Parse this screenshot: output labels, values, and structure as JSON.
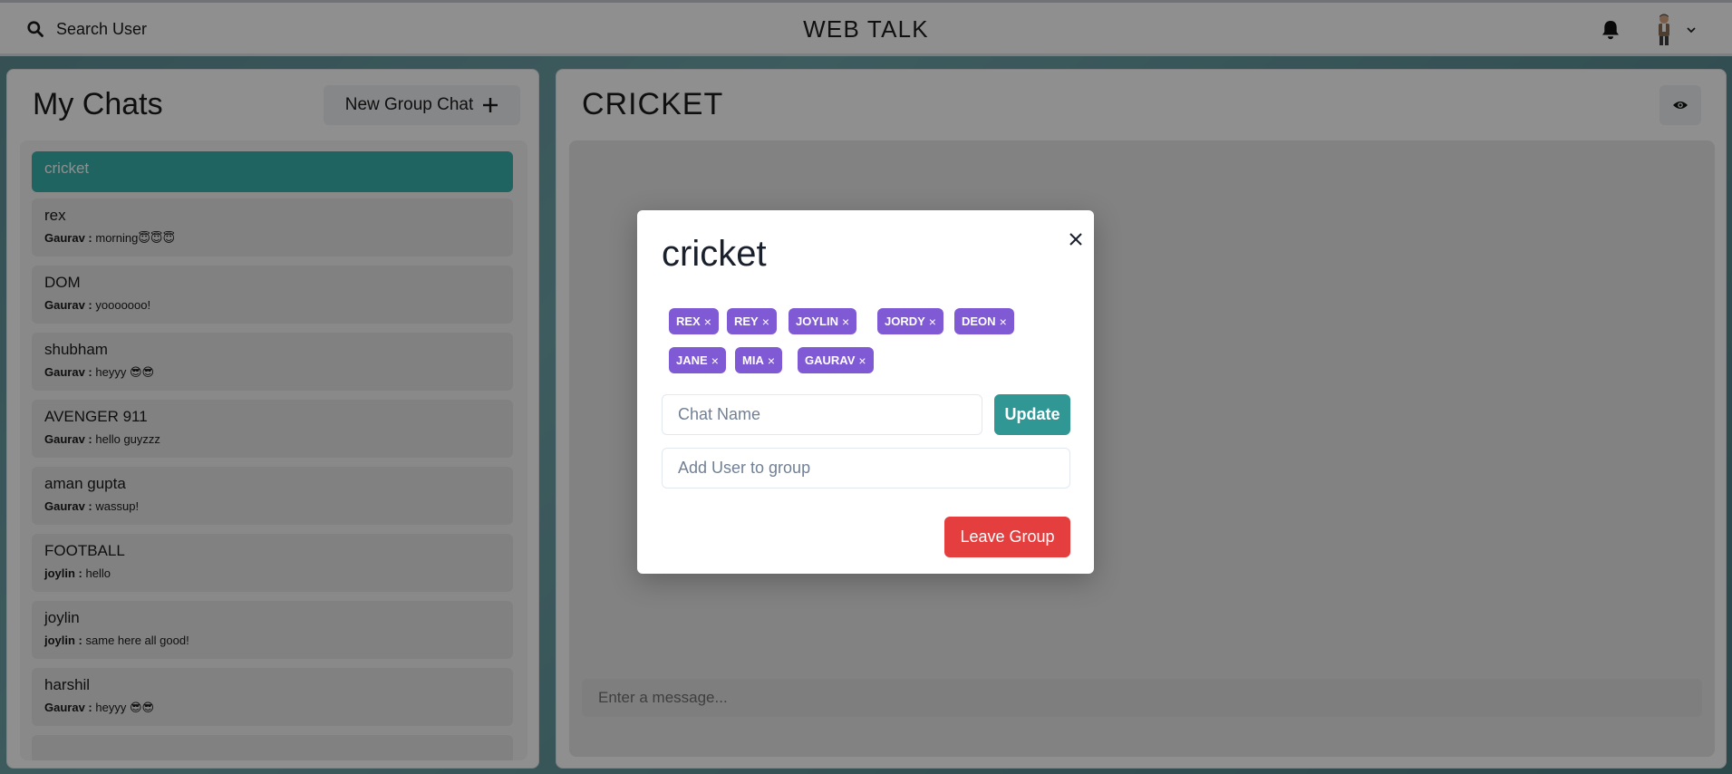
{
  "topbar": {
    "search_label": "Search User",
    "brand": "WEB TALK",
    "icons": {
      "search": "search-icon",
      "bell": "bell-icon",
      "avatar": "avatar",
      "chevron": "chevron-down-icon"
    }
  },
  "sidebar": {
    "title": "My Chats",
    "new_group_label": "New Group Chat",
    "chats": [
      {
        "name": "cricket",
        "sender": "",
        "message": "",
        "active": true
      },
      {
        "name": "rex",
        "sender": "Gaurav :",
        "message": "morning😇😇😇"
      },
      {
        "name": "DOM",
        "sender": "Gaurav :",
        "message": "yooooooo!"
      },
      {
        "name": "shubham",
        "sender": "Gaurav :",
        "message": "heyyy 😎😎"
      },
      {
        "name": "AVENGER 911",
        "sender": "Gaurav :",
        "message": "hello guyzzz"
      },
      {
        "name": "aman gupta",
        "sender": "Gaurav :",
        "message": "wassup!"
      },
      {
        "name": "FOOTBALL",
        "sender": "joylin :",
        "message": "hello"
      },
      {
        "name": "joylin",
        "sender": "joylin :",
        "message": "same here all good!"
      },
      {
        "name": "harshil",
        "sender": "Gaurav :",
        "message": "heyyy 😎😎"
      }
    ]
  },
  "chat": {
    "title": "CRICKET",
    "message_placeholder": "Enter a message..."
  },
  "modal": {
    "title": "cricket",
    "members": [
      "REX",
      "REY",
      "JOYLIN",
      "JORDY",
      "DEON",
      "JANE",
      "MIA",
      "GAURAV"
    ],
    "remove_glyph": "×",
    "chat_name_placeholder": "Chat Name",
    "update_label": "Update",
    "add_user_placeholder": "Add User to group",
    "leave_label": "Leave Group"
  },
  "colors": {
    "accent_teal": "#38b2ac",
    "update_teal": "#319795",
    "badge_purple": "#805ad5",
    "leave_red": "#e53e3e"
  }
}
